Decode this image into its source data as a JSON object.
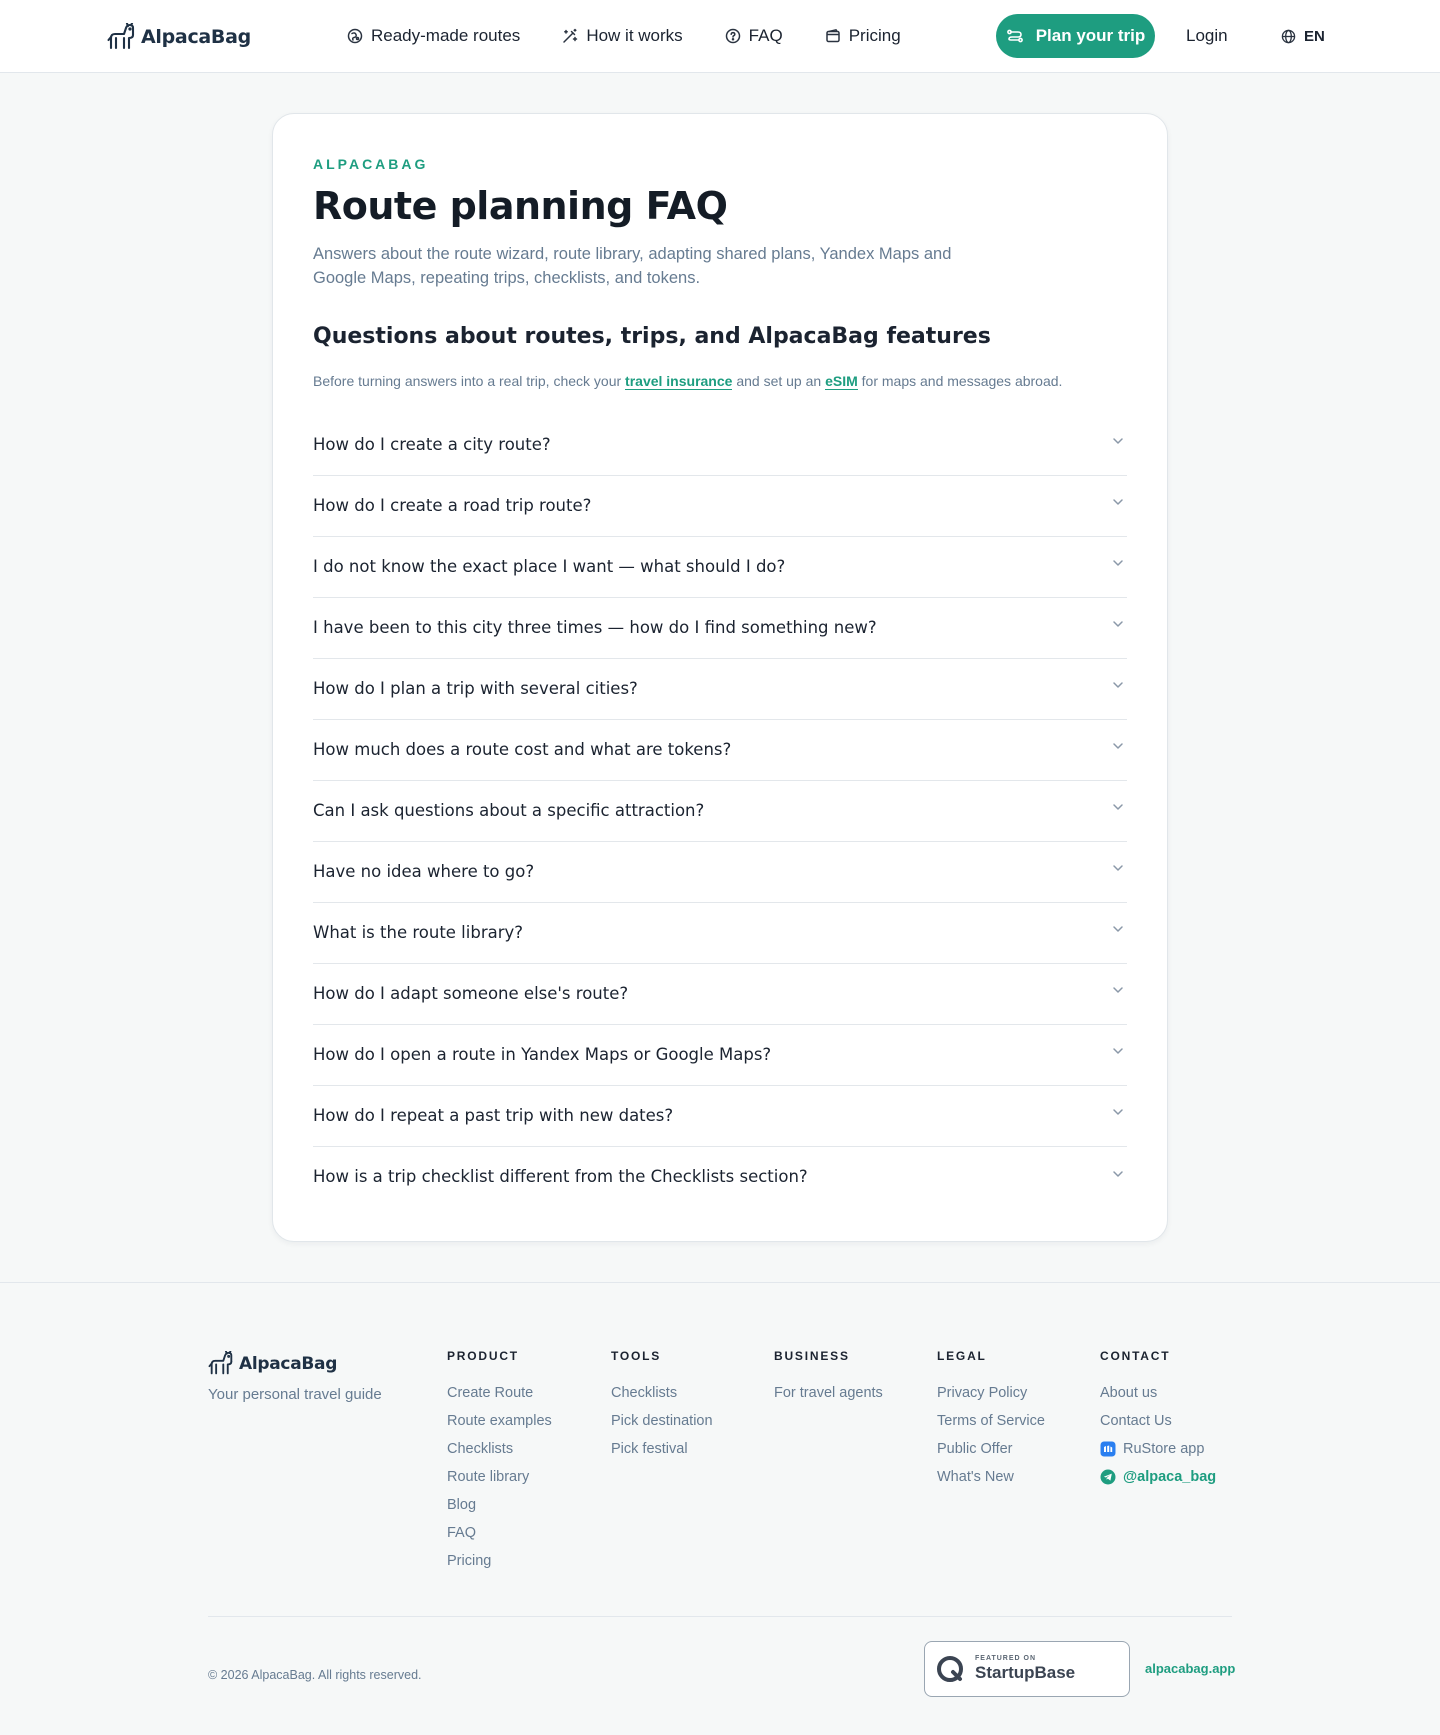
{
  "brand": {
    "name": "AlpacaBag",
    "accent": "#1e9d80",
    "text_dark": "#1b2330",
    "text_muted": "#667b91"
  },
  "header": {
    "logo_icon": "alpaca-icon",
    "nav": [
      {
        "label": "Ready-made routes",
        "icon": "route-icon"
      },
      {
        "label": "How it works",
        "icon": "magic-wand-icon"
      },
      {
        "label": "FAQ",
        "icon": "question-circle-icon"
      },
      {
        "label": "Pricing",
        "icon": "wallet-icon"
      }
    ],
    "cta_label": "Plan your trip",
    "login_label": "Login",
    "lang_label": "EN"
  },
  "faq": {
    "eyebrow": "ALPACABAG",
    "title": "Route planning FAQ",
    "lead": "Answers about the route wizard, route library, adapting shared plans, Yandex Maps and Google Maps, repeating trips, checklists, and tokens.",
    "section_title": "Questions about routes, trips, and AlpacaBag features",
    "note": {
      "before": "Before turning answers into a real trip, check your ",
      "link1": "travel insurance",
      "middle": " and set up an ",
      "link2": "eSIM",
      "after": " for maps and messages abroad."
    },
    "questions": [
      "How do I create a city route?",
      "How do I create a road trip route?",
      "I do not know the exact place I want — what should I do?",
      "I have been to this city three times — how do I find something new?",
      "How do I plan a trip with several cities?",
      "How much does a route cost and what are tokens?",
      "Can I ask questions about a specific attraction?",
      "Have no idea where to go?",
      "What is the route library?",
      "How do I adapt someone else's route?",
      "How do I open a route in Yandex Maps or Google Maps?",
      "How do I repeat a past trip with new dates?",
      "How is a trip checklist different from the Checklists section?"
    ]
  },
  "footer": {
    "brand_name": "AlpacaBag",
    "tagline": "Your personal travel guide",
    "columns": [
      {
        "title": "PRODUCT",
        "links": [
          "Create Route",
          "Route examples",
          "Checklists",
          "Route library",
          "Blog",
          "FAQ",
          "Pricing"
        ]
      },
      {
        "title": "TOOLS",
        "links": [
          "Checklists",
          "Pick destination",
          "Pick festival"
        ]
      },
      {
        "title": "BUSINESS",
        "links": [
          "For travel agents"
        ]
      },
      {
        "title": "LEGAL",
        "links": [
          "Privacy Policy",
          "Terms of Service",
          "Public Offer",
          "What's New"
        ]
      },
      {
        "title": "CONTACT",
        "links": [
          "About us",
          "Contact Us",
          "RuStore app",
          "@alpaca_bag"
        ]
      }
    ],
    "copyright": "© 2026 AlpacaBag. All rights reserved.",
    "badge_small": "FEATURED ON",
    "badge_big": "StartupBase",
    "site_link": "alpacabag.app"
  }
}
